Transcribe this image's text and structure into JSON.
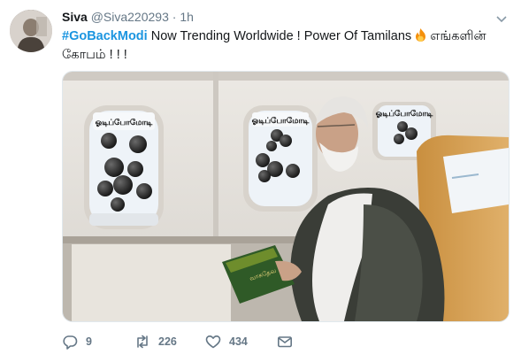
{
  "tweet": {
    "display_name": "Siva",
    "handle": "@Siva220293",
    "separator": "·",
    "time": "1h",
    "hashtag": "#GoBackModi",
    "text": " Now Trending Worldwide ! Power Of Tamilans ",
    "emoji_icon": "fire-emoji",
    "tamil_text": " எங்களின் கோபம் ! ! !"
  },
  "media": {
    "balloon_card_labels": [
      "ஓடிப்போமோடி",
      "ஓடிப்போமோடி",
      "ஓடிப்போமோடி"
    ],
    "book_text": "வாசுதேவ"
  },
  "actions": {
    "reply_count": "9",
    "retweet_count": "226",
    "like_count": "434"
  },
  "icons": [
    "caret-down-icon",
    "reply-icon",
    "retweet-icon",
    "like-icon",
    "dm-icon"
  ],
  "colors": {
    "accent": "#1b95e0",
    "muted": "#657786",
    "text": "#14171a"
  }
}
